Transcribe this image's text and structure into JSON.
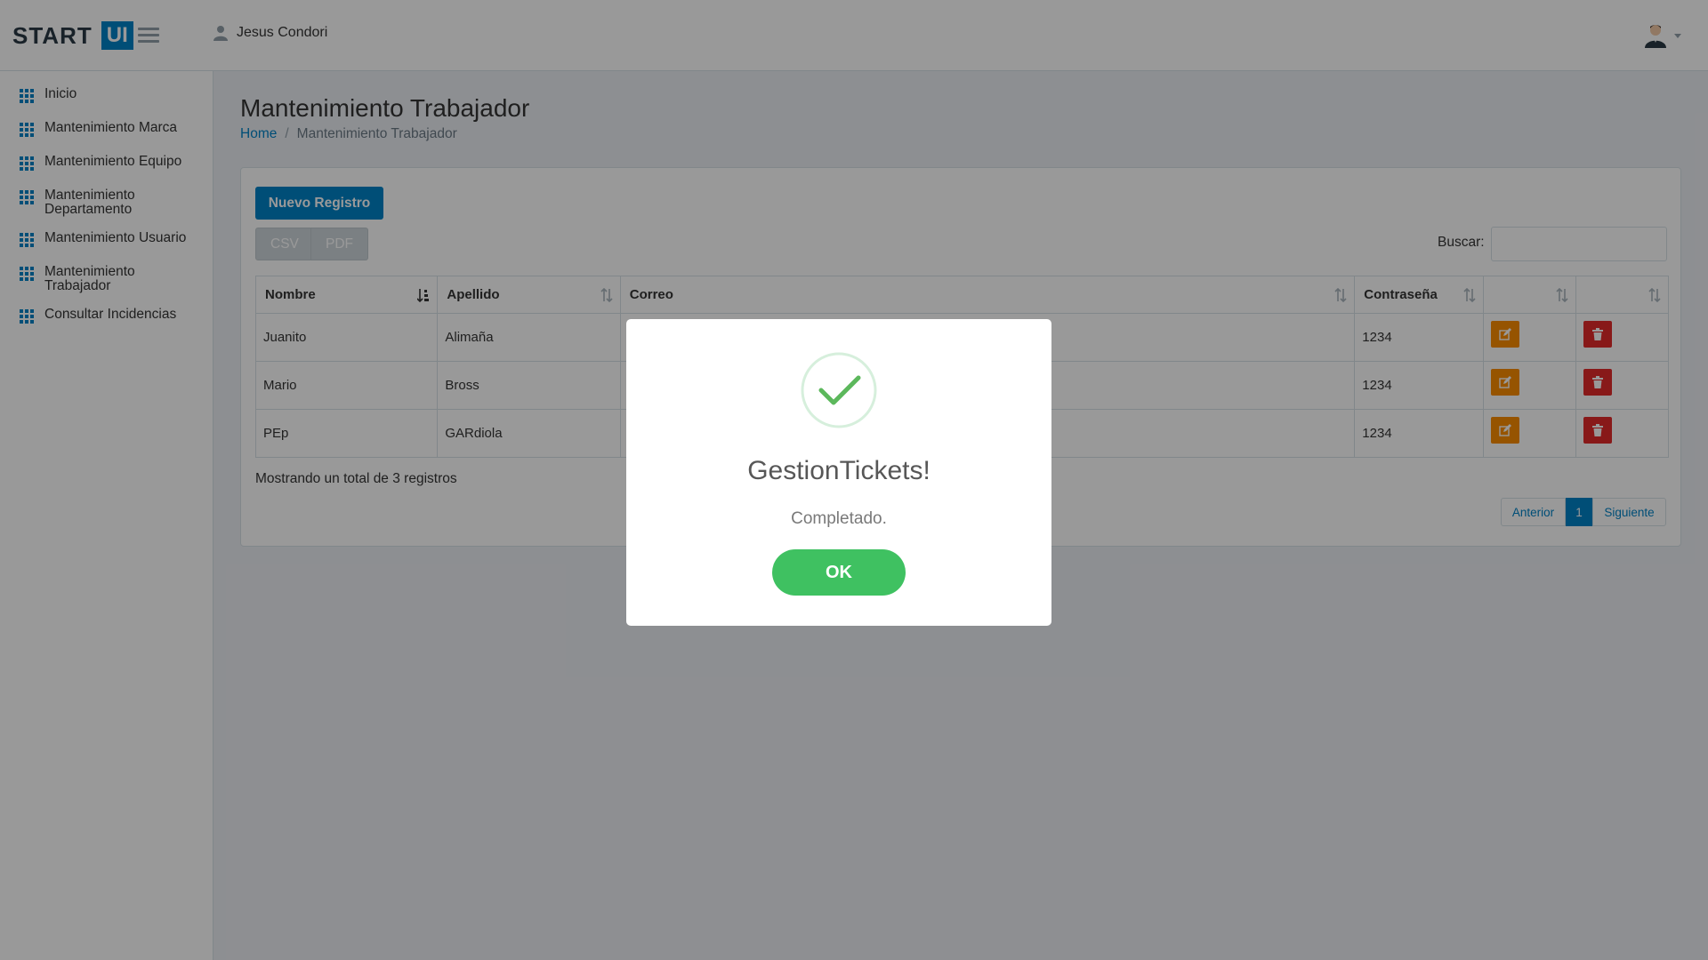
{
  "header": {
    "logo_start": "START",
    "logo_ui": "UI",
    "user_name": "Jesus Condori"
  },
  "sidebar": {
    "items": [
      {
        "label": "Inicio"
      },
      {
        "label": "Mantenimiento Marca"
      },
      {
        "label": "Mantenimiento Equipo"
      },
      {
        "label": "Mantenimiento Departamento"
      },
      {
        "label": "Mantenimiento Usuario"
      },
      {
        "label": "Mantenimiento Trabajador"
      },
      {
        "label": "Consultar Incidencias"
      }
    ]
  },
  "main": {
    "title": "Mantenimiento Trabajador",
    "breadcrumb": {
      "home": "Home",
      "current": "Mantenimiento Trabajador"
    },
    "new_button": "Nuevo Registro",
    "export": {
      "csv": "CSV",
      "pdf": "PDF"
    },
    "search": {
      "label": "Buscar:",
      "value": ""
    },
    "table": {
      "headers": [
        "Nombre",
        "Apellido",
        "Correo",
        "Contraseña",
        "",
        ""
      ],
      "rows": [
        {
          "nombre": "Juanito",
          "apellido": "Alimaña",
          "correo": "",
          "contrasena": "1234"
        },
        {
          "nombre": "Mario",
          "apellido": "Bross",
          "correo": "",
          "contrasena": "1234"
        },
        {
          "nombre": "PEp",
          "apellido": "GARdiola",
          "correo": "",
          "contrasena": "1234"
        }
      ]
    },
    "info": "Mostrando un total de 3 registros",
    "pagination": {
      "prev": "Anterior",
      "current": "1",
      "next": "Siguiente"
    }
  },
  "modal": {
    "title": "GestionTickets!",
    "text": "Completado.",
    "ok_label": "OK"
  },
  "colors": {
    "primary": "#0082c6",
    "edit": "#fa8c00",
    "delete": "#e32b2b",
    "success": "#3fc161"
  },
  "icons": {
    "sidebar": "grid-icon",
    "edit": "pencil-square-icon",
    "delete": "trash-icon",
    "modal": "checkmark-icon"
  }
}
